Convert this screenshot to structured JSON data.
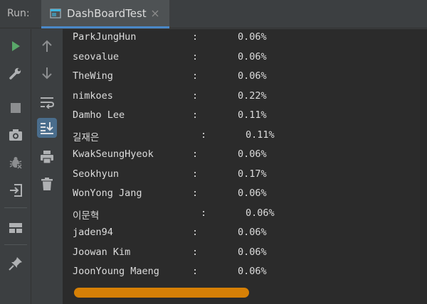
{
  "run_panel": {
    "label": "Run:",
    "tab_title": "DashBoardTest"
  },
  "icons": {
    "run": "play-icon",
    "settings": "wrench-icon",
    "stop": "stop-icon",
    "screenshot": "camera-icon",
    "debug": "bug-icon",
    "exit": "exit-icon",
    "layout": "layout-icon",
    "pin": "pin-icon",
    "up": "arrow-up-icon",
    "down": "arrow-down-icon",
    "wrap": "soft-wrap-icon",
    "scroll_end": "scroll-to-end-icon",
    "print": "print-icon",
    "trash": "trash-icon"
  },
  "colors": {
    "accent": "#4a88c7",
    "run_green": "#59a869",
    "scrollbar": "#d68006"
  },
  "console": {
    "lines": [
      {
        "name": "ParkJungHun",
        "sep": ":",
        "pct": "0.06%"
      },
      {
        "name": "seovalue",
        "sep": ":",
        "pct": "0.06%"
      },
      {
        "name": "TheWing",
        "sep": ":",
        "pct": "0.06%"
      },
      {
        "name": "nimkoes",
        "sep": ":",
        "pct": "0.22%"
      },
      {
        "name": "Damho Lee",
        "sep": ":",
        "pct": "0.11%"
      },
      {
        "name": "길재은",
        "sep": ":",
        "pct": "0.11%"
      },
      {
        "name": "KwakSeungHyeok",
        "sep": ":",
        "pct": "0.06%"
      },
      {
        "name": "Seokhyun",
        "sep": ":",
        "pct": "0.17%"
      },
      {
        "name": "WonYong Jang",
        "sep": ":",
        "pct": "0.06%"
      },
      {
        "name": "이문혁",
        "sep": ":",
        "pct": "0.06%"
      },
      {
        "name": "jaden94",
        "sep": ":",
        "pct": "0.06%"
      },
      {
        "name": "Joowan Kim",
        "sep": ":",
        "pct": "0.06%"
      },
      {
        "name": "JoonYoung Maeng",
        "sep": ":",
        "pct": "0.06%"
      }
    ]
  }
}
